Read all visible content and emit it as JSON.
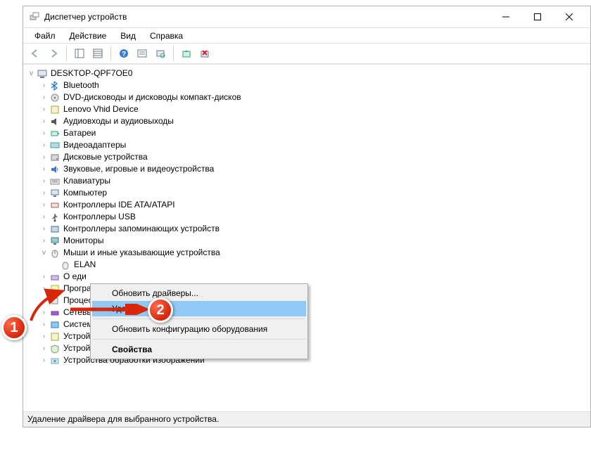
{
  "window": {
    "title": "Диспетчер устройств"
  },
  "menubar": [
    "Файл",
    "Действие",
    "Вид",
    "Справка"
  ],
  "tree": {
    "root": {
      "label": "DESKTOP-QPF7OE0"
    },
    "items": [
      "Bluetooth",
      "DVD-дисководы и дисководы компакт-дисков",
      "Lenovo Vhid Device",
      "Аудиовходы и аудиовыходы",
      "Батареи",
      "Видеоадаптеры",
      "Дисковые устройства",
      "Звуковые, игровые и видеоустройства",
      "Клавиатуры",
      "Компьютер",
      "Контроллеры IDE ATA/ATAPI",
      "Контроллеры USB",
      "Контроллеры запоминающих устройств",
      "Мониторы"
    ],
    "expanded": {
      "label": "Мыши и иные указывающие устройства",
      "children": [
        "ELAN",
        "О     еди",
        "Програм",
        "Процесс",
        "Сетевые",
        "Системн"
      ]
    },
    "after": [
      "Устройства HID (Human Interface Devices)",
      "Устройства безопасности",
      "Устройства обработки изображений"
    ]
  },
  "contextMenu": {
    "items": [
      "Обновить драйверы...",
      "Удалить",
      "Обновить конфигурацию оборудования",
      "Свойства"
    ]
  },
  "statusbar": "Удаление драйвера для выбранного устройства.",
  "badges": {
    "1": "1",
    "2": "2"
  }
}
